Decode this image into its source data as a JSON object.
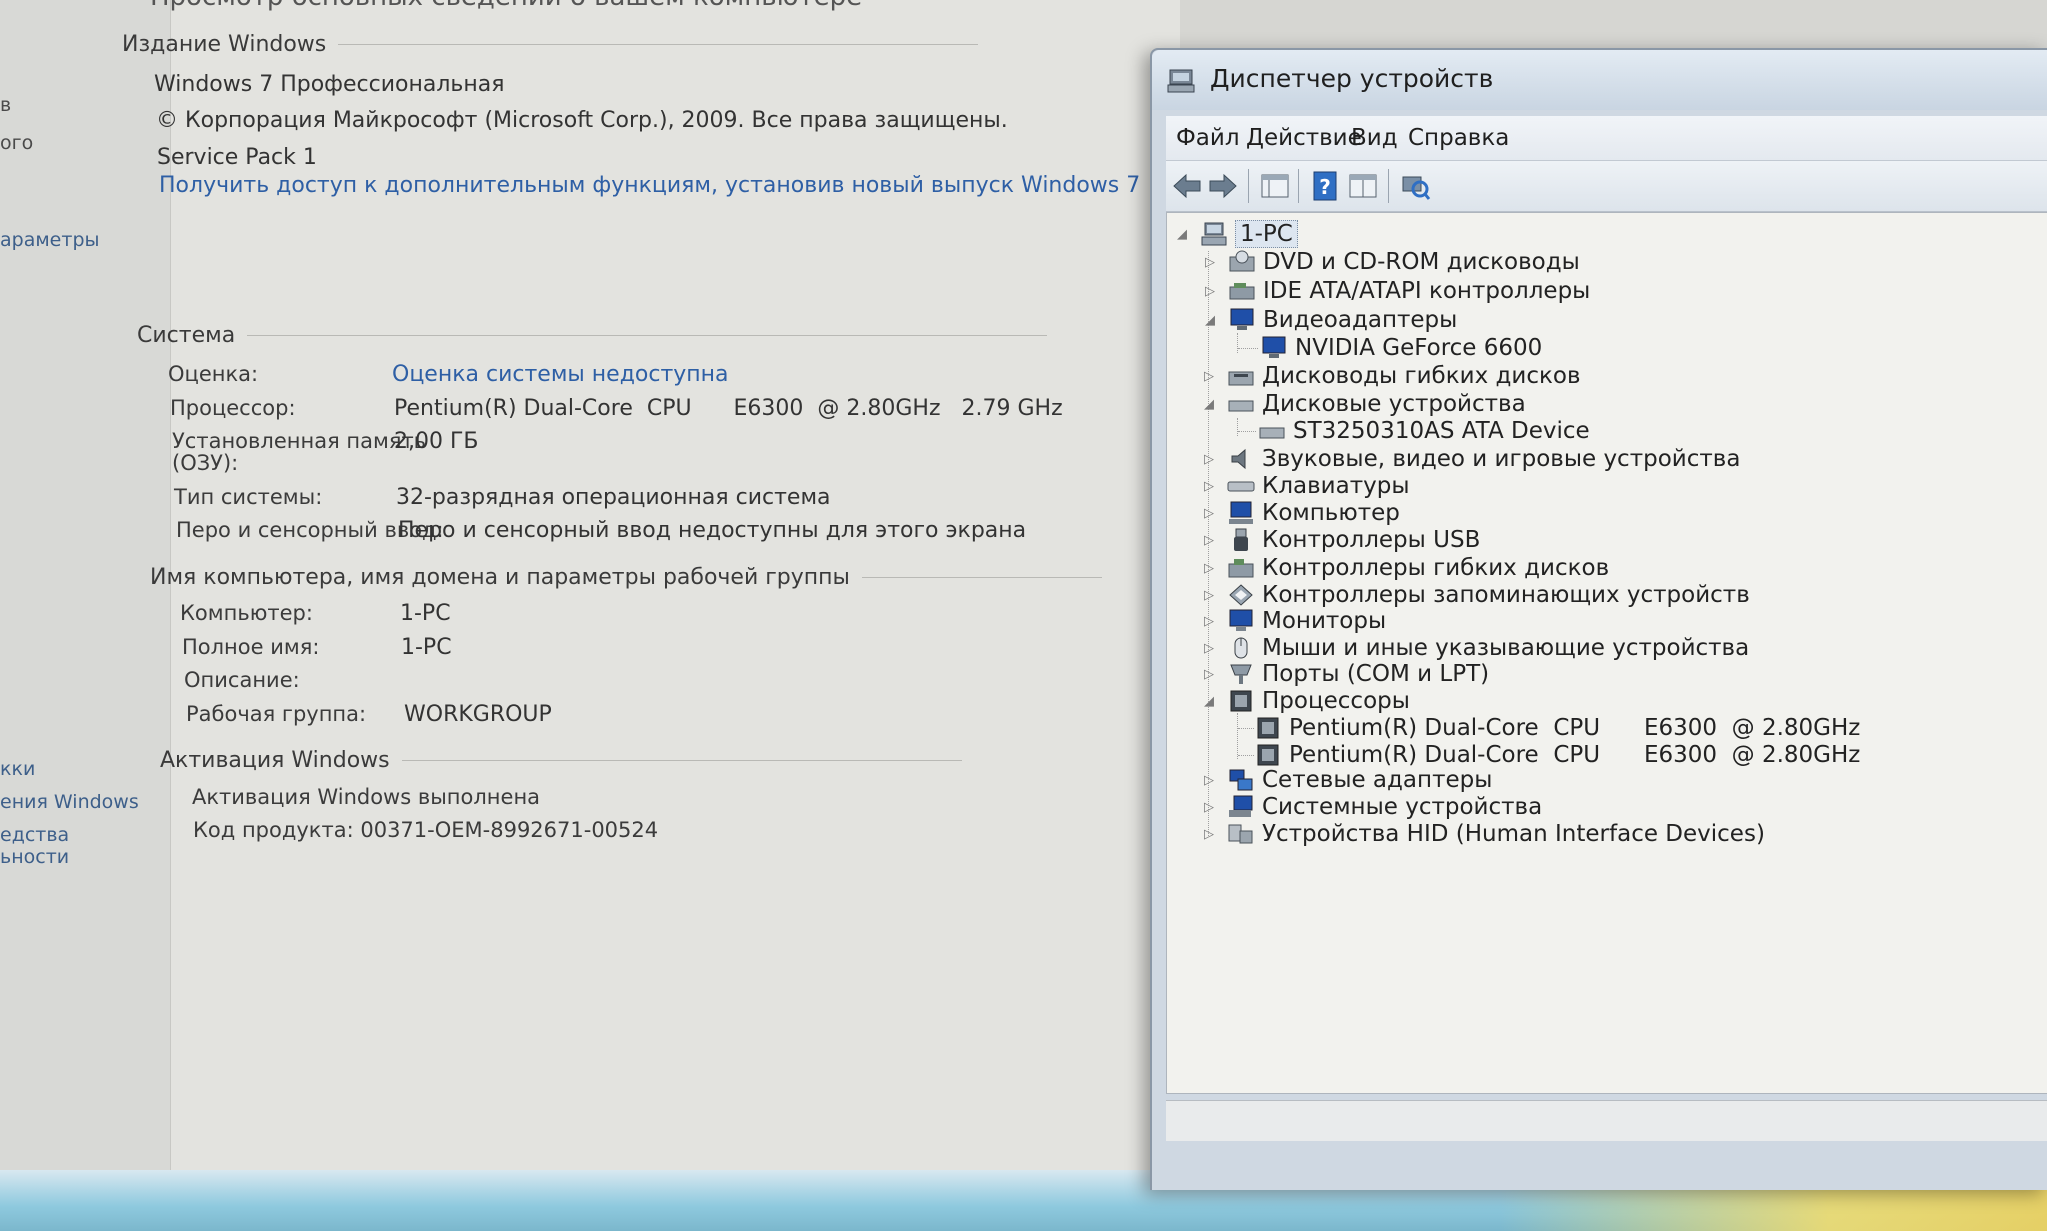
{
  "system": {
    "title_fragment": "Просмотр основных сведений о вашем компьютере",
    "left_nav": {
      "frag1": "в",
      "frag2": "ого",
      "frag3": "араметры",
      "frag4": "кки",
      "frag5": "ения Windows",
      "frag6": "едства",
      "frag7": "ьности"
    },
    "edition": {
      "heading": "Издание Windows",
      "name": "Windows 7 Профессиональная",
      "copyright": "© Корпорация Майкрософт (Microsoft Corp.), 2009. Все права защищены.",
      "service_pack": "Service Pack 1",
      "upgrade_link": "Получить доступ к дополнительным функциям, установив новый выпуск Windows 7"
    },
    "system_section": {
      "heading": "Система",
      "rows": [
        {
          "label": "Оценка:",
          "value": "Оценка системы недоступна",
          "link": true
        },
        {
          "label": "Процессор:",
          "value": "Pentium(R) Dual-Core  CPU      E6300  @ 2.80GHz   2.79 GHz"
        },
        {
          "label": "Установленная память (ОЗУ):",
          "label2": "(ОЗУ):",
          "label1": "Установленная память",
          "value": "2,00 ГБ"
        },
        {
          "label": "Тип системы:",
          "value": "32-разрядная операционная система"
        },
        {
          "label": "Перо и сенсорный ввод:",
          "value": "Перо и сенсорный ввод недоступны для этого экрана"
        }
      ]
    },
    "computer_section": {
      "heading": "Имя компьютера, имя домена и параметры рабочей группы",
      "rows": [
        {
          "label": "Компьютер:",
          "value": "1-PC"
        },
        {
          "label": "Полное имя:",
          "value": "1-PC"
        },
        {
          "label": "Описание:",
          "value": ""
        },
        {
          "label": "Рабочая группа:",
          "value": "WORKGROUP"
        }
      ]
    },
    "activation": {
      "heading": "Активация Windows",
      "status": "Активация Windows выполнена",
      "product_key": "Код продукта: 00371-OEM-8992671-00524"
    }
  },
  "device_manager": {
    "title": "Диспетчер устройств",
    "menu": [
      "Файл",
      "Действие",
      "Вид",
      "Справка"
    ],
    "toolbar": [
      "back-icon",
      "forward-icon",
      "properties-icon",
      "help-icon",
      "view-icon",
      "scan-hardware-icon"
    ],
    "root": "1-PC",
    "tree": [
      {
        "label": "DVD и CD-ROM дисководы",
        "icon": "dvd-icon",
        "expanded": false
      },
      {
        "label": "IDE ATA/ATAPI контроллеры",
        "icon": "ide-controller-icon",
        "expanded": false
      },
      {
        "label": "Видеоадаптеры",
        "icon": "display-adapter-icon",
        "expanded": true,
        "children": [
          "NVIDIA GeForce 6600"
        ]
      },
      {
        "label": "Дисководы гибких дисков",
        "icon": "floppy-drive-icon",
        "expanded": false
      },
      {
        "label": "Дисковые устройства",
        "icon": "disk-drive-icon",
        "expanded": true,
        "children": [
          "ST3250310AS ATA Device"
        ]
      },
      {
        "label": "Звуковые, видео и игровые устройства",
        "icon": "sound-icon",
        "expanded": false
      },
      {
        "label": "Клавиатуры",
        "icon": "keyboard-icon",
        "expanded": false
      },
      {
        "label": "Компьютер",
        "icon": "computer-icon",
        "expanded": false
      },
      {
        "label": "Контроллеры USB",
        "icon": "usb-icon",
        "expanded": false
      },
      {
        "label": "Контроллеры гибких дисков",
        "icon": "floppy-controller-icon",
        "expanded": false
      },
      {
        "label": "Контроллеры запоминающих устройств",
        "icon": "storage-controller-icon",
        "expanded": false
      },
      {
        "label": "Мониторы",
        "icon": "monitor-icon",
        "expanded": false
      },
      {
        "label": "Мыши и иные указывающие устройства",
        "icon": "mouse-icon",
        "expanded": false
      },
      {
        "label": "Порты (COM и LPT)",
        "icon": "port-icon",
        "expanded": false
      },
      {
        "label": "Процессоры",
        "icon": "processor-icon",
        "expanded": true,
        "children": [
          "Pentium(R) Dual-Core  CPU      E6300  @ 2.80GHz",
          "Pentium(R) Dual-Core  CPU      E6300  @ 2.80GHz"
        ]
      },
      {
        "label": "Сетевые адаптеры",
        "icon": "network-adapter-icon",
        "expanded": false
      },
      {
        "label": "Системные устройства",
        "icon": "system-devices-icon",
        "expanded": false
      },
      {
        "label": "Устройства HID (Human Interface Devices)",
        "icon": "hid-icon",
        "expanded": false
      }
    ]
  }
}
